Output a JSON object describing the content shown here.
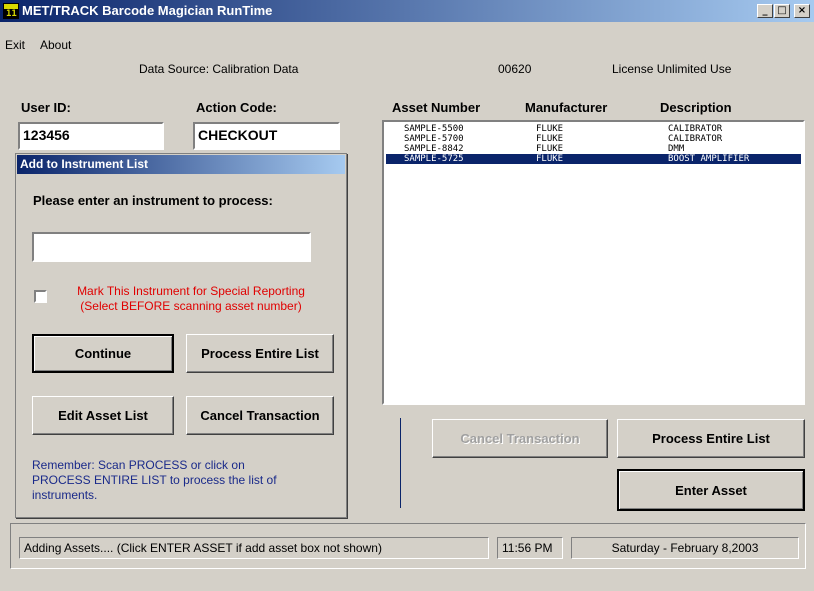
{
  "window": {
    "title": "MET/TRACK Barcode Magician RunTime",
    "icon": "mettrack-app-icon",
    "icon_text": "11",
    "controls": {
      "minimize": "_",
      "maximize": "□",
      "close": "×"
    }
  },
  "menu": {
    "items": [
      "Exit",
      "About"
    ]
  },
  "info": {
    "data_source": "Data Source:  Calibration Data",
    "code": "00620",
    "license": "License Unlimited Use"
  },
  "form": {
    "user_id_label": "User ID:",
    "user_id_value": "123456",
    "action_code_label": "Action Code:",
    "action_code_value": "CHECKOUT"
  },
  "dialog": {
    "title": "Add to Instrument List",
    "prompt": "Please enter an instrument to process:",
    "instrument_input": "",
    "special_line1": "Mark This Instrument for Special Reporting",
    "special_line2": "(Select BEFORE scanning asset number)",
    "continue_button": "Continue",
    "process_list_button": "Process Entire List",
    "edit_list_button": "Edit Asset List",
    "cancel_button": "Cancel Transaction",
    "reminder_line1": "Remember: Scan  PROCESS  or click on",
    "reminder_line2": "PROCESS ENTIRE LIST to process the list of",
    "reminder_line3": "instruments."
  },
  "asset_list": {
    "headers": [
      "Asset Number",
      "Manufacturer",
      "Description"
    ],
    "rows": [
      {
        "asset": "SAMPLE-5500",
        "manufacturer": "FLUKE",
        "description": "CALIBRATOR"
      },
      {
        "asset": "SAMPLE-5700",
        "manufacturer": "FLUKE",
        "description": "CALIBRATOR"
      },
      {
        "asset": "SAMPLE-8842",
        "manufacturer": "FLUKE",
        "description": "DMM"
      },
      {
        "asset": "SAMPLE-5725",
        "manufacturer": "FLUKE",
        "description": "BOOST AMPLIFIER"
      }
    ],
    "selected_row": 3
  },
  "actions": {
    "cancel_transaction": "Cancel Transaction",
    "process_entire_list": "Process Entire List",
    "enter_asset": "Enter Asset"
  },
  "status": {
    "message": "Adding Assets.... (Click ENTER ASSET if add asset box not shown)",
    "time": "11:56 PM",
    "date": "Saturday - February 8,2003"
  },
  "colors": {
    "titlebar_start": "#0a246a",
    "titlebar_end": "#a6caf0",
    "window_bg": "#d4d0c8",
    "selection": "#0a246a",
    "special_text": "#e00000",
    "reminder_text": "#1a2a8a"
  }
}
